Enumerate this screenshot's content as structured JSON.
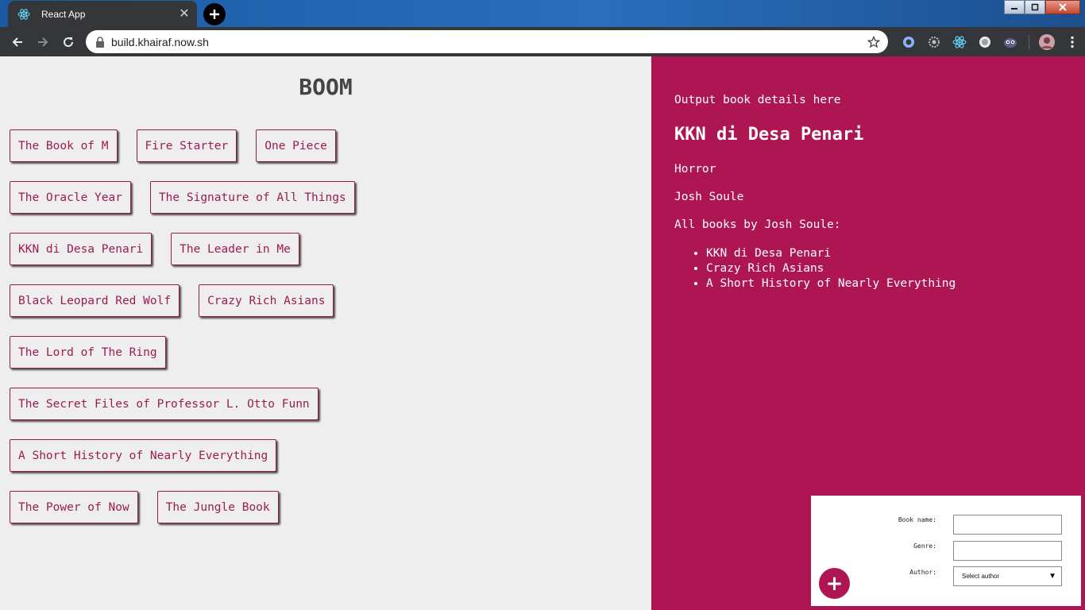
{
  "browser": {
    "tab_title": "React App",
    "tab_close": "✕",
    "new_tab": "+",
    "url": "build.khairaf.now.sh"
  },
  "app": {
    "heading": "BOOM",
    "books": [
      "The Book of M",
      "Fire Starter",
      "One Piece",
      "The Oracle Year",
      "The Signature of All Things",
      "KKN di Desa Penari",
      "The Leader in Me",
      "Black Leopard Red Wolf",
      "Crazy Rich Asians",
      "The Lord of The Ring",
      "The Secret Files of Professor L. Otto Funn",
      "A Short History of Nearly Everything",
      "The Power of Now",
      "The Jungle Book"
    ]
  },
  "details": {
    "heading": "Output book details here",
    "name": "KKN di Desa Penari",
    "genre": "Horror",
    "author": "Josh Soule",
    "all_books_label": "All books by Josh Soule:",
    "author_books": [
      "KKN di Desa Penari",
      "Crazy Rich Asians",
      "A Short History of Nearly Everything"
    ]
  },
  "form": {
    "book_name_label": "Book name:",
    "genre_label": "Genre:",
    "author_label": "Author:",
    "book_name_value": "",
    "genre_value": "",
    "author_selected": "Select author",
    "select_arrow": "▼",
    "add_button": "+"
  },
  "colors": {
    "accent": "#ae1653",
    "book_text": "#9b1c53",
    "left_bg": "#eeeeee",
    "chrome_dark": "#35363a"
  },
  "icons": [
    "react-icon",
    "back-arrow-icon",
    "forward-arrow-icon",
    "reload-icon",
    "lock-icon",
    "star-icon",
    "menu-dots-icon"
  ]
}
